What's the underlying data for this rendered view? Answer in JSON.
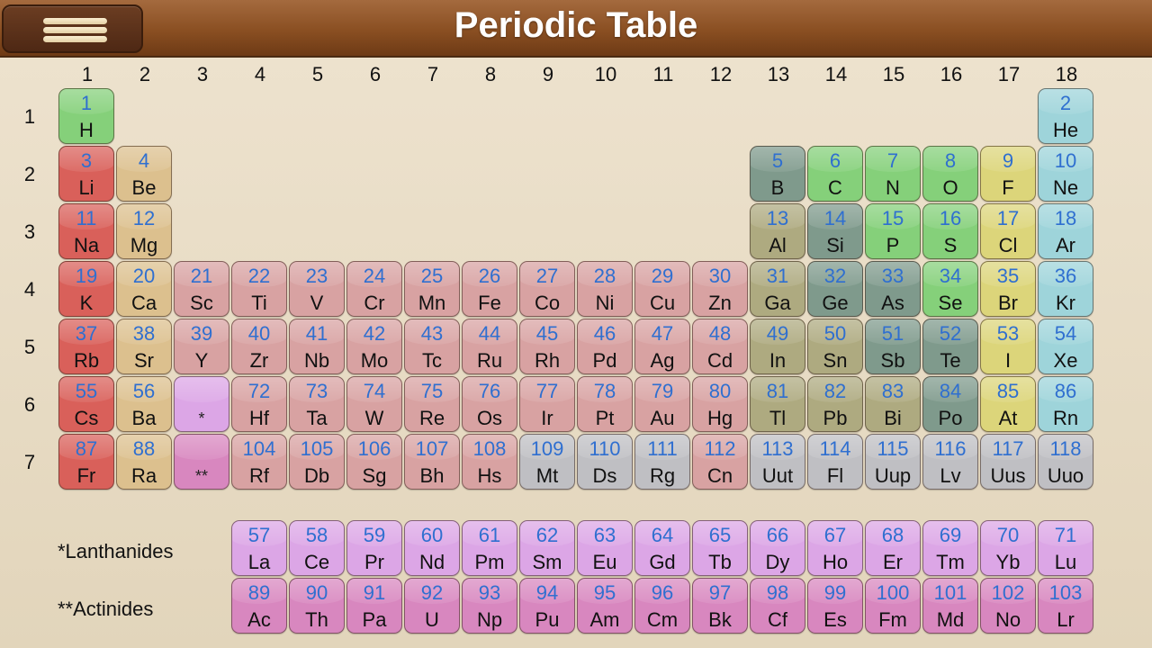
{
  "header": {
    "title": "Periodic Table",
    "menu_icon": "hamburger-menu-icon"
  },
  "groups": [
    "1",
    "2",
    "3",
    "4",
    "5",
    "6",
    "7",
    "8",
    "9",
    "10",
    "11",
    "12",
    "13",
    "14",
    "15",
    "16",
    "17",
    "18"
  ],
  "periods": [
    "1",
    "2",
    "3",
    "4",
    "5",
    "6",
    "7"
  ],
  "colors": {
    "alkali": "#d9605a",
    "alkaline": "#dcc08e",
    "transition": "#d8a2a2",
    "nonmetal": "#85d07a",
    "metalloid": "#7f9a8c",
    "post": "#aeaa80",
    "halogen": "#dcd57a",
    "noble": "#9ed4da",
    "unknown": "#bfbfc3",
    "lanthanide": "#dca6e6",
    "actinide": "#d887bf"
  },
  "elements": [
    {
      "n": "1",
      "s": "H",
      "g": 1,
      "p": 1,
      "c": "nonmetal"
    },
    {
      "n": "2",
      "s": "He",
      "g": 18,
      "p": 1,
      "c": "noble"
    },
    {
      "n": "3",
      "s": "Li",
      "g": 1,
      "p": 2,
      "c": "alkali"
    },
    {
      "n": "4",
      "s": "Be",
      "g": 2,
      "p": 2,
      "c": "alkaline"
    },
    {
      "n": "5",
      "s": "B",
      "g": 13,
      "p": 2,
      "c": "metalloid"
    },
    {
      "n": "6",
      "s": "C",
      "g": 14,
      "p": 2,
      "c": "nonmetal"
    },
    {
      "n": "7",
      "s": "N",
      "g": 15,
      "p": 2,
      "c": "nonmetal"
    },
    {
      "n": "8",
      "s": "O",
      "g": 16,
      "p": 2,
      "c": "nonmetal"
    },
    {
      "n": "9",
      "s": "F",
      "g": 17,
      "p": 2,
      "c": "halogen"
    },
    {
      "n": "10",
      "s": "Ne",
      "g": 18,
      "p": 2,
      "c": "noble"
    },
    {
      "n": "11",
      "s": "Na",
      "g": 1,
      "p": 3,
      "c": "alkali"
    },
    {
      "n": "12",
      "s": "Mg",
      "g": 2,
      "p": 3,
      "c": "alkaline"
    },
    {
      "n": "13",
      "s": "Al",
      "g": 13,
      "p": 3,
      "c": "post"
    },
    {
      "n": "14",
      "s": "Si",
      "g": 14,
      "p": 3,
      "c": "metalloid"
    },
    {
      "n": "15",
      "s": "P",
      "g": 15,
      "p": 3,
      "c": "nonmetal"
    },
    {
      "n": "16",
      "s": "S",
      "g": 16,
      "p": 3,
      "c": "nonmetal"
    },
    {
      "n": "17",
      "s": "Cl",
      "g": 17,
      "p": 3,
      "c": "halogen"
    },
    {
      "n": "18",
      "s": "Ar",
      "g": 18,
      "p": 3,
      "c": "noble"
    },
    {
      "n": "19",
      "s": "K",
      "g": 1,
      "p": 4,
      "c": "alkali"
    },
    {
      "n": "20",
      "s": "Ca",
      "g": 2,
      "p": 4,
      "c": "alkaline"
    },
    {
      "n": "21",
      "s": "Sc",
      "g": 3,
      "p": 4,
      "c": "transition"
    },
    {
      "n": "22",
      "s": "Ti",
      "g": 4,
      "p": 4,
      "c": "transition"
    },
    {
      "n": "23",
      "s": "V",
      "g": 5,
      "p": 4,
      "c": "transition"
    },
    {
      "n": "24",
      "s": "Cr",
      "g": 6,
      "p": 4,
      "c": "transition"
    },
    {
      "n": "25",
      "s": "Mn",
      "g": 7,
      "p": 4,
      "c": "transition"
    },
    {
      "n": "26",
      "s": "Fe",
      "g": 8,
      "p": 4,
      "c": "transition"
    },
    {
      "n": "27",
      "s": "Co",
      "g": 9,
      "p": 4,
      "c": "transition"
    },
    {
      "n": "28",
      "s": "Ni",
      "g": 10,
      "p": 4,
      "c": "transition"
    },
    {
      "n": "29",
      "s": "Cu",
      "g": 11,
      "p": 4,
      "c": "transition"
    },
    {
      "n": "30",
      "s": "Zn",
      "g": 12,
      "p": 4,
      "c": "transition"
    },
    {
      "n": "31",
      "s": "Ga",
      "g": 13,
      "p": 4,
      "c": "post"
    },
    {
      "n": "32",
      "s": "Ge",
      "g": 14,
      "p": 4,
      "c": "metalloid"
    },
    {
      "n": "33",
      "s": "As",
      "g": 15,
      "p": 4,
      "c": "metalloid"
    },
    {
      "n": "34",
      "s": "Se",
      "g": 16,
      "p": 4,
      "c": "nonmetal"
    },
    {
      "n": "35",
      "s": "Br",
      "g": 17,
      "p": 4,
      "c": "halogen"
    },
    {
      "n": "36",
      "s": "Kr",
      "g": 18,
      "p": 4,
      "c": "noble"
    },
    {
      "n": "37",
      "s": "Rb",
      "g": 1,
      "p": 5,
      "c": "alkali"
    },
    {
      "n": "38",
      "s": "Sr",
      "g": 2,
      "p": 5,
      "c": "alkaline"
    },
    {
      "n": "39",
      "s": "Y",
      "g": 3,
      "p": 5,
      "c": "transition"
    },
    {
      "n": "40",
      "s": "Zr",
      "g": 4,
      "p": 5,
      "c": "transition"
    },
    {
      "n": "41",
      "s": "Nb",
      "g": 5,
      "p": 5,
      "c": "transition"
    },
    {
      "n": "42",
      "s": "Mo",
      "g": 6,
      "p": 5,
      "c": "transition"
    },
    {
      "n": "43",
      "s": "Tc",
      "g": 7,
      "p": 5,
      "c": "transition"
    },
    {
      "n": "44",
      "s": "Ru",
      "g": 8,
      "p": 5,
      "c": "transition"
    },
    {
      "n": "45",
      "s": "Rh",
      "g": 9,
      "p": 5,
      "c": "transition"
    },
    {
      "n": "46",
      "s": "Pd",
      "g": 10,
      "p": 5,
      "c": "transition"
    },
    {
      "n": "47",
      "s": "Ag",
      "g": 11,
      "p": 5,
      "c": "transition"
    },
    {
      "n": "48",
      "s": "Cd",
      "g": 12,
      "p": 5,
      "c": "transition"
    },
    {
      "n": "49",
      "s": "In",
      "g": 13,
      "p": 5,
      "c": "post"
    },
    {
      "n": "50",
      "s": "Sn",
      "g": 14,
      "p": 5,
      "c": "post"
    },
    {
      "n": "51",
      "s": "Sb",
      "g": 15,
      "p": 5,
      "c": "metalloid"
    },
    {
      "n": "52",
      "s": "Te",
      "g": 16,
      "p": 5,
      "c": "metalloid"
    },
    {
      "n": "53",
      "s": "I",
      "g": 17,
      "p": 5,
      "c": "halogen"
    },
    {
      "n": "54",
      "s": "Xe",
      "g": 18,
      "p": 5,
      "c": "noble"
    },
    {
      "n": "55",
      "s": "Cs",
      "g": 1,
      "p": 6,
      "c": "alkali"
    },
    {
      "n": "56",
      "s": "Ba",
      "g": 2,
      "p": 6,
      "c": "alkaline"
    },
    {
      "n": "",
      "s": "*",
      "g": 3,
      "p": 6,
      "c": "lanthanide",
      "mark": true
    },
    {
      "n": "72",
      "s": "Hf",
      "g": 4,
      "p": 6,
      "c": "transition"
    },
    {
      "n": "73",
      "s": "Ta",
      "g": 5,
      "p": 6,
      "c": "transition"
    },
    {
      "n": "74",
      "s": "W",
      "g": 6,
      "p": 6,
      "c": "transition"
    },
    {
      "n": "75",
      "s": "Re",
      "g": 7,
      "p": 6,
      "c": "transition"
    },
    {
      "n": "76",
      "s": "Os",
      "g": 8,
      "p": 6,
      "c": "transition"
    },
    {
      "n": "77",
      "s": "Ir",
      "g": 9,
      "p": 6,
      "c": "transition"
    },
    {
      "n": "78",
      "s": "Pt",
      "g": 10,
      "p": 6,
      "c": "transition"
    },
    {
      "n": "79",
      "s": "Au",
      "g": 11,
      "p": 6,
      "c": "transition"
    },
    {
      "n": "80",
      "s": "Hg",
      "g": 12,
      "p": 6,
      "c": "transition"
    },
    {
      "n": "81",
      "s": "Tl",
      "g": 13,
      "p": 6,
      "c": "post"
    },
    {
      "n": "82",
      "s": "Pb",
      "g": 14,
      "p": 6,
      "c": "post"
    },
    {
      "n": "83",
      "s": "Bi",
      "g": 15,
      "p": 6,
      "c": "post"
    },
    {
      "n": "84",
      "s": "Po",
      "g": 16,
      "p": 6,
      "c": "metalloid"
    },
    {
      "n": "85",
      "s": "At",
      "g": 17,
      "p": 6,
      "c": "halogen"
    },
    {
      "n": "86",
      "s": "Rn",
      "g": 18,
      "p": 6,
      "c": "noble"
    },
    {
      "n": "87",
      "s": "Fr",
      "g": 1,
      "p": 7,
      "c": "alkali"
    },
    {
      "n": "88",
      "s": "Ra",
      "g": 2,
      "p": 7,
      "c": "alkaline"
    },
    {
      "n": "",
      "s": "**",
      "g": 3,
      "p": 7,
      "c": "actinide",
      "mark": true
    },
    {
      "n": "104",
      "s": "Rf",
      "g": 4,
      "p": 7,
      "c": "transition"
    },
    {
      "n": "105",
      "s": "Db",
      "g": 5,
      "p": 7,
      "c": "transition"
    },
    {
      "n": "106",
      "s": "Sg",
      "g": 6,
      "p": 7,
      "c": "transition"
    },
    {
      "n": "107",
      "s": "Bh",
      "g": 7,
      "p": 7,
      "c": "transition"
    },
    {
      "n": "108",
      "s": "Hs",
      "g": 8,
      "p": 7,
      "c": "transition"
    },
    {
      "n": "109",
      "s": "Mt",
      "g": 9,
      "p": 7,
      "c": "unknown"
    },
    {
      "n": "110",
      "s": "Ds",
      "g": 10,
      "p": 7,
      "c": "unknown"
    },
    {
      "n": "111",
      "s": "Rg",
      "g": 11,
      "p": 7,
      "c": "unknown"
    },
    {
      "n": "112",
      "s": "Cn",
      "g": 12,
      "p": 7,
      "c": "transition"
    },
    {
      "n": "113",
      "s": "Uut",
      "g": 13,
      "p": 7,
      "c": "unknown"
    },
    {
      "n": "114",
      "s": "Fl",
      "g": 14,
      "p": 7,
      "c": "unknown"
    },
    {
      "n": "115",
      "s": "Uup",
      "g": 15,
      "p": 7,
      "c": "unknown"
    },
    {
      "n": "116",
      "s": "Lv",
      "g": 16,
      "p": 7,
      "c": "unknown"
    },
    {
      "n": "117",
      "s": "Uus",
      "g": 17,
      "p": 7,
      "c": "unknown"
    },
    {
      "n": "118",
      "s": "Uuo",
      "g": 18,
      "p": 7,
      "c": "unknown"
    }
  ],
  "lanthanides": {
    "label": "*Lanthanides",
    "elements": [
      {
        "n": "57",
        "s": "La"
      },
      {
        "n": "58",
        "s": "Ce"
      },
      {
        "n": "59",
        "s": "Pr"
      },
      {
        "n": "60",
        "s": "Nd"
      },
      {
        "n": "61",
        "s": "Pm"
      },
      {
        "n": "62",
        "s": "Sm"
      },
      {
        "n": "63",
        "s": "Eu"
      },
      {
        "n": "64",
        "s": "Gd"
      },
      {
        "n": "65",
        "s": "Tb"
      },
      {
        "n": "66",
        "s": "Dy"
      },
      {
        "n": "67",
        "s": "Ho"
      },
      {
        "n": "68",
        "s": "Er"
      },
      {
        "n": "69",
        "s": "Tm"
      },
      {
        "n": "70",
        "s": "Yb"
      },
      {
        "n": "71",
        "s": "Lu"
      }
    ]
  },
  "actinides": {
    "label": "**Actinides",
    "elements": [
      {
        "n": "89",
        "s": "Ac"
      },
      {
        "n": "90",
        "s": "Th"
      },
      {
        "n": "91",
        "s": "Pa"
      },
      {
        "n": "92",
        "s": "U"
      },
      {
        "n": "93",
        "s": "Np"
      },
      {
        "n": "94",
        "s": "Pu"
      },
      {
        "n": "95",
        "s": "Am"
      },
      {
        "n": "96",
        "s": "Cm"
      },
      {
        "n": "97",
        "s": "Bk"
      },
      {
        "n": "98",
        "s": "Cf"
      },
      {
        "n": "99",
        "s": "Es"
      },
      {
        "n": "100",
        "s": "Fm"
      },
      {
        "n": "101",
        "s": "Md"
      },
      {
        "n": "102",
        "s": "No"
      },
      {
        "n": "103",
        "s": "Lr"
      }
    ]
  }
}
